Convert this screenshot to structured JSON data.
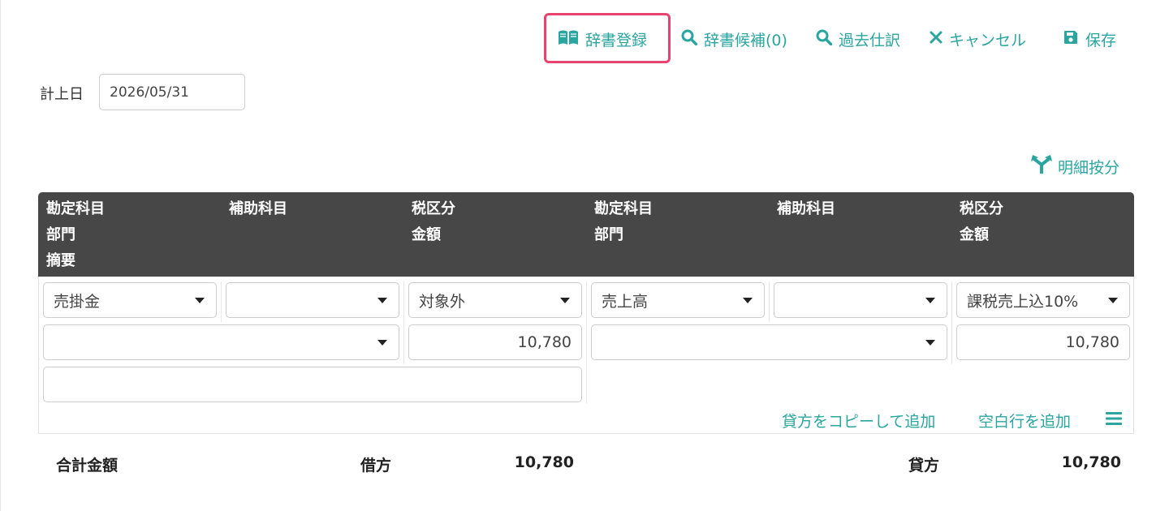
{
  "toolbar": {
    "dict_register": "辞書登録",
    "dict_candidates": "辞書候補(0)",
    "past_entries": "過去仕訳",
    "cancel": "キャンセル",
    "save": "保存"
  },
  "date": {
    "label": "計上日",
    "value": "2026/05/31"
  },
  "split_label": "明細按分",
  "headers": {
    "debit": {
      "account": "勘定科目",
      "sub_account": "補助科目",
      "tax": "税区分",
      "department": "部門",
      "amount": "金額",
      "memo": "摘要"
    },
    "credit": {
      "account": "勘定科目",
      "sub_account": "補助科目",
      "tax": "税区分",
      "department": "部門",
      "amount": "金額"
    }
  },
  "row": {
    "debit": {
      "account": "売掛金",
      "sub_account": "",
      "tax": "対象外",
      "department": "",
      "amount": "10,780",
      "memo": ""
    },
    "credit": {
      "account": "売上高",
      "sub_account": "",
      "tax": "課税売上込10%",
      "department": "",
      "amount": "10,780"
    }
  },
  "row_actions": {
    "copy_credit": "貸方をコピーして追加",
    "add_blank": "空白行を追加"
  },
  "totals": {
    "label": "合計金額",
    "debit_label": "借方",
    "debit_value": "10,780",
    "credit_label": "貸方",
    "credit_value": "10,780"
  },
  "colors": {
    "accent": "#2aa5a0",
    "header_bg": "#474747",
    "highlight": "#e8426e"
  }
}
